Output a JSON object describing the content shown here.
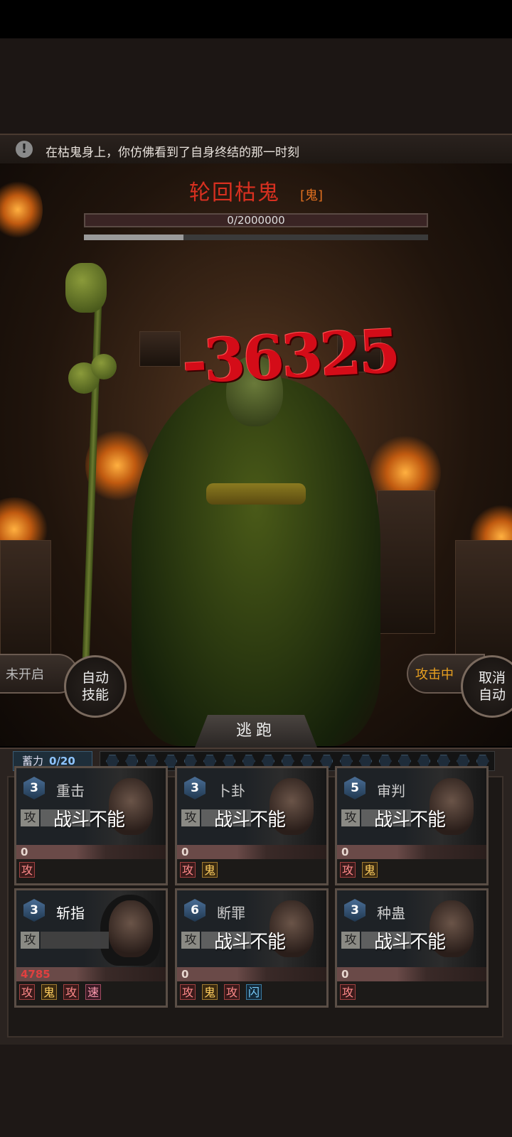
{
  "notice": {
    "icon": "info-icon",
    "glyph": "!",
    "text": "在枯鬼身上，你仿佛看到了自身终结的那一时刻"
  },
  "boss": {
    "name": "轮回枯鬼",
    "type": "[鬼]",
    "hp_text": "0/2000000",
    "hp_fraction": 0.0,
    "sub_fraction": 0.29
  },
  "damage": "-36325",
  "left_control": {
    "status": "未开启",
    "button": "自动\n技能"
  },
  "right_control": {
    "status": "攻击中",
    "button": "取消\n自动"
  },
  "flee": "逃跑",
  "charge": {
    "label": "蓄力",
    "value": "0/20",
    "total_pips": 20
  },
  "colors": {
    "boss_name": "#d83020",
    "boss_type": "#e07020",
    "damage": "#d40c18",
    "attacking": "#e8a020",
    "charge_value": "#8ec4ff"
  },
  "cards": [
    {
      "level": "3",
      "skill": "重击",
      "status": "战斗不能",
      "atk": "攻",
      "value": "0",
      "tags": [
        "攻"
      ]
    },
    {
      "level": "3",
      "skill": "卜卦",
      "status": "战斗不能",
      "atk": "攻",
      "value": "0",
      "tags": [
        "攻",
        "鬼"
      ]
    },
    {
      "level": "5",
      "skill": "审判",
      "status": "战斗不能",
      "atk": "攻",
      "value": "0",
      "tags": [
        "攻",
        "鬼"
      ]
    },
    {
      "level": "3",
      "skill": "斩指",
      "status": "",
      "atk": "攻",
      "value": "4785",
      "tags": [
        "攻",
        "鬼",
        "攻",
        "速"
      ]
    },
    {
      "level": "6",
      "skill": "断罪",
      "status": "战斗不能",
      "atk": "攻",
      "value": "0",
      "tags": [
        "攻",
        "鬼",
        "攻",
        "闪"
      ]
    },
    {
      "level": "3",
      "skill": "种蛊",
      "status": "战斗不能",
      "atk": "攻",
      "value": "0",
      "tags": [
        "攻"
      ]
    }
  ]
}
